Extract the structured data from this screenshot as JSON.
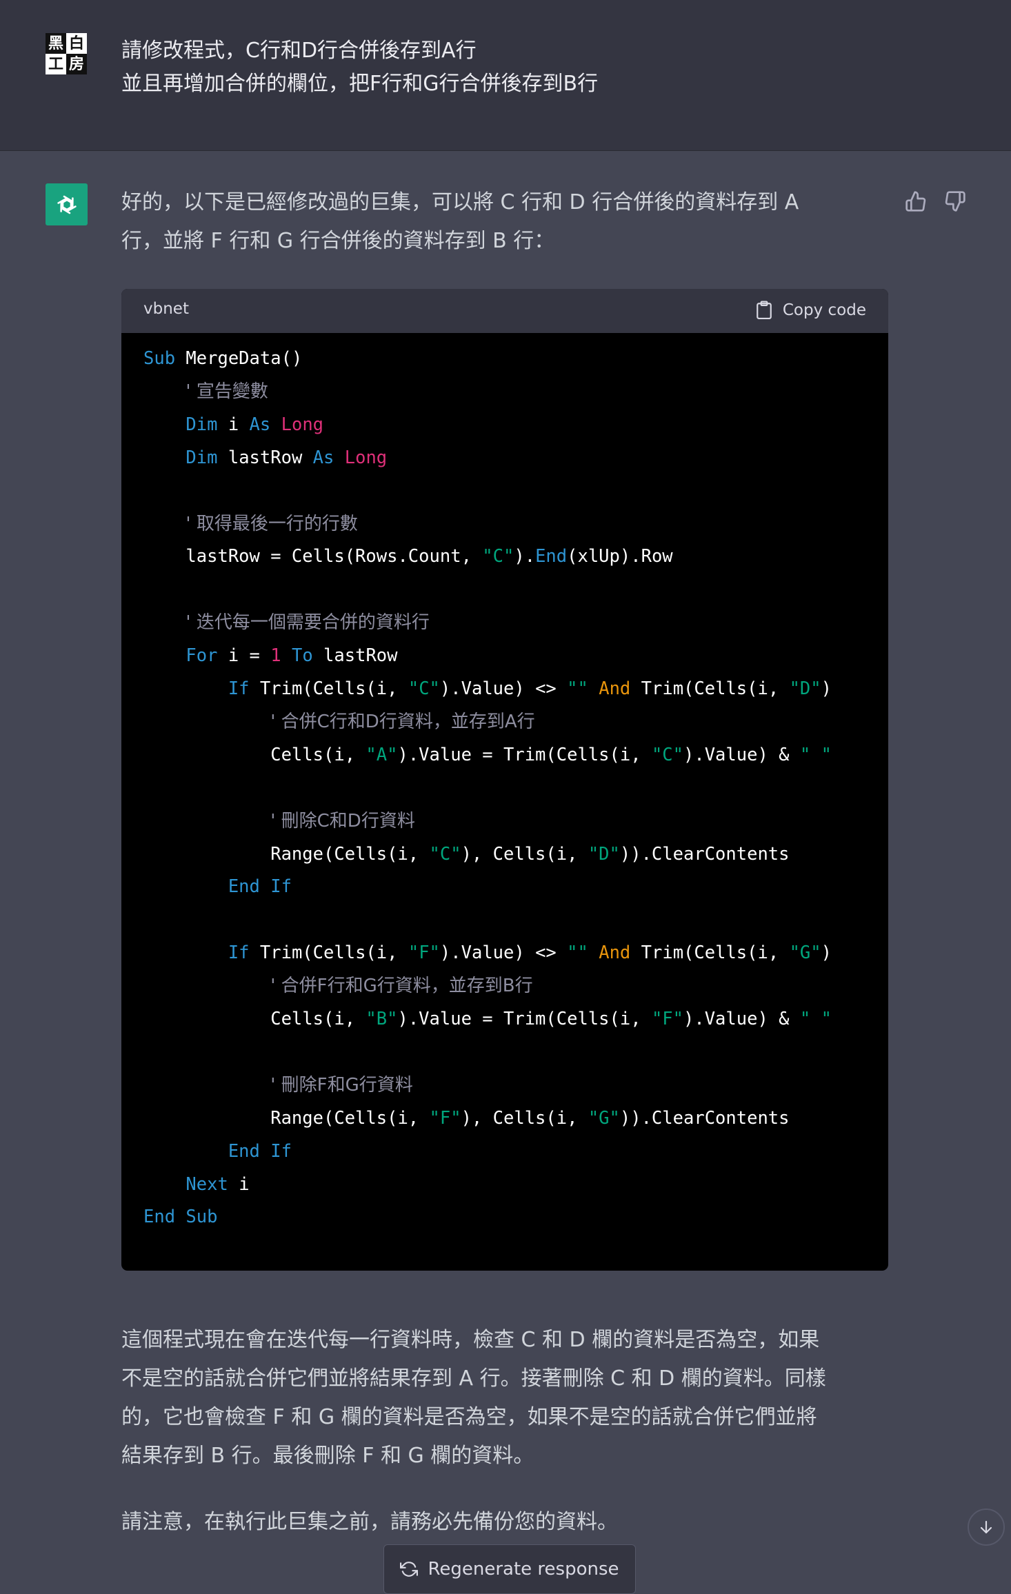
{
  "user_message": {
    "avatar_chars": [
      "黑",
      "白",
      "工",
      "房"
    ],
    "lines": [
      "請修改程式，C行和D行合併後存到A行",
      "並且再增加合併的欄位，把F行和G行合併後存到B行"
    ]
  },
  "assistant": {
    "intro_lines": [
      "好的，以下是已經修改過的巨集，可以將 C 行和 D 行合併後的資料存到 A",
      "行，並將 F 行和 G 行合併後的資料存到 B 行："
    ],
    "code_block": {
      "language": "vbnet",
      "copy_label": "Copy code",
      "lines": [
        [
          {
            "c": "k",
            "v": "Sub"
          },
          {
            "v": " MergeData()"
          }
        ],
        [
          {
            "v": "    "
          },
          {
            "c": "c",
            "v": "' 宣告變數"
          }
        ],
        [
          {
            "v": "    "
          },
          {
            "c": "k",
            "v": "Dim"
          },
          {
            "v": " i "
          },
          {
            "c": "k",
            "v": "As"
          },
          {
            "v": " "
          },
          {
            "c": "t",
            "v": "Long"
          }
        ],
        [
          {
            "v": "    "
          },
          {
            "c": "k",
            "v": "Dim"
          },
          {
            "v": " lastRow "
          },
          {
            "c": "k",
            "v": "As"
          },
          {
            "v": " "
          },
          {
            "c": "t",
            "v": "Long"
          }
        ],
        [],
        [
          {
            "v": "    "
          },
          {
            "c": "c",
            "v": "' 取得最後一行的行數"
          }
        ],
        [
          {
            "v": "    lastRow = Cells(Rows.Count, "
          },
          {
            "c": "s",
            "v": "\"C\""
          },
          {
            "v": ")."
          },
          {
            "c": "k",
            "v": "End"
          },
          {
            "v": "(xlUp).Row"
          }
        ],
        [],
        [
          {
            "v": "    "
          },
          {
            "c": "c",
            "v": "' 迭代每一個需要合併的資料行"
          }
        ],
        [
          {
            "v": "    "
          },
          {
            "c": "k",
            "v": "For"
          },
          {
            "v": " i = "
          },
          {
            "c": "n",
            "v": "1"
          },
          {
            "v": " "
          },
          {
            "c": "k",
            "v": "To"
          },
          {
            "v": " lastRow"
          }
        ],
        [
          {
            "v": "        "
          },
          {
            "c": "k",
            "v": "If"
          },
          {
            "v": " Trim(Cells(i, "
          },
          {
            "c": "s",
            "v": "\"C\""
          },
          {
            "v": ").Value) <> "
          },
          {
            "c": "s",
            "v": "\"\""
          },
          {
            "v": " "
          },
          {
            "c": "o",
            "v": "And"
          },
          {
            "v": " Trim(Cells(i, "
          },
          {
            "c": "s",
            "v": "\"D\""
          },
          {
            "v": ")"
          }
        ],
        [
          {
            "v": "            "
          },
          {
            "c": "c",
            "v": "' 合併C行和D行資料，並存到A行"
          }
        ],
        [
          {
            "v": "            Cells(i, "
          },
          {
            "c": "s",
            "v": "\"A\""
          },
          {
            "v": ").Value = Trim(Cells(i, "
          },
          {
            "c": "s",
            "v": "\"C\""
          },
          {
            "v": ").Value) & "
          },
          {
            "c": "s",
            "v": "\" \""
          }
        ],
        [],
        [
          {
            "v": "            "
          },
          {
            "c": "c",
            "v": "' 刪除C和D行資料"
          }
        ],
        [
          {
            "v": "            Range(Cells(i, "
          },
          {
            "c": "s",
            "v": "\"C\""
          },
          {
            "v": "), Cells(i, "
          },
          {
            "c": "s",
            "v": "\"D\""
          },
          {
            "v": ")).ClearContents"
          }
        ],
        [
          {
            "v": "        "
          },
          {
            "c": "k",
            "v": "End If"
          }
        ],
        [],
        [
          {
            "v": "        "
          },
          {
            "c": "k",
            "v": "If"
          },
          {
            "v": " Trim(Cells(i, "
          },
          {
            "c": "s",
            "v": "\"F\""
          },
          {
            "v": ").Value) <> "
          },
          {
            "c": "s",
            "v": "\"\""
          },
          {
            "v": " "
          },
          {
            "c": "o",
            "v": "And"
          },
          {
            "v": " Trim(Cells(i, "
          },
          {
            "c": "s",
            "v": "\"G\""
          },
          {
            "v": ")"
          }
        ],
        [
          {
            "v": "            "
          },
          {
            "c": "c",
            "v": "' 合併F行和G行資料，並存到B行"
          }
        ],
        [
          {
            "v": "            Cells(i, "
          },
          {
            "c": "s",
            "v": "\"B\""
          },
          {
            "v": ").Value = Trim(Cells(i, "
          },
          {
            "c": "s",
            "v": "\"F\""
          },
          {
            "v": ").Value) & "
          },
          {
            "c": "s",
            "v": "\" \""
          }
        ],
        [],
        [
          {
            "v": "            "
          },
          {
            "c": "c",
            "v": "' 刪除F和G行資料"
          }
        ],
        [
          {
            "v": "            Range(Cells(i, "
          },
          {
            "c": "s",
            "v": "\"F\""
          },
          {
            "v": "), Cells(i, "
          },
          {
            "c": "s",
            "v": "\"G\""
          },
          {
            "v": ")).ClearContents"
          }
        ],
        [
          {
            "v": "        "
          },
          {
            "c": "k",
            "v": "End If"
          }
        ],
        [
          {
            "v": "    "
          },
          {
            "c": "k",
            "v": "Next"
          },
          {
            "v": " i"
          }
        ],
        [
          {
            "c": "k",
            "v": "End Sub"
          }
        ]
      ]
    },
    "explanation_lines": [
      "這個程式現在會在迭代每一行資料時，檢查 C 和 D 欄的資料是否為空，如果",
      "不是空的話就合併它們並將結果存到 A 行。接著刪除 C 和 D 欄的資料。同樣",
      "的，它也會檢查 F 和 G 欄的資料是否為空，如果不是空的話就合併它們並將",
      "結果存到 B 行。最後刪除 F 和 G 欄的資料。"
    ],
    "note": "請注意，在執行此巨集之前，請務必先備份您的資料。"
  },
  "regenerate_label": "Regenerate response",
  "icons": [
    "thumbs-up-icon",
    "thumbs-down-icon",
    "clipboard-icon",
    "refresh-icon",
    "arrow-down-icon",
    "chatgpt-logo-icon"
  ],
  "colors": {
    "assistant_bg": "#444654",
    "user_bg": "#343541",
    "avatar_green": "#19a37f",
    "code_bg": "#000000",
    "keyword": "#2e95d3",
    "type": "#df3079",
    "string": "#00a67d",
    "operator": "#e9950c",
    "comment": "#8e8ea0"
  }
}
